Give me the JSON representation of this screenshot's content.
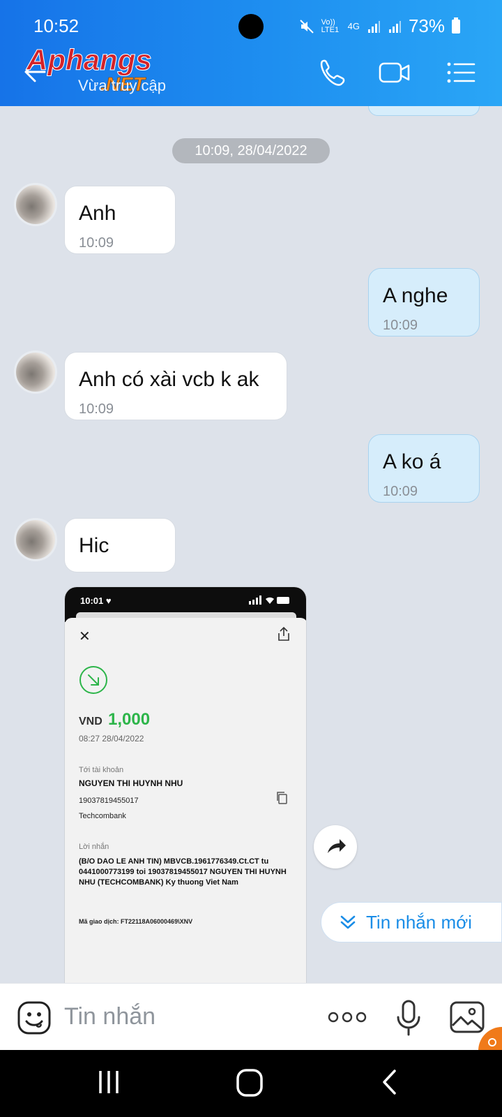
{
  "status_bar": {
    "time": "10:52",
    "network_line1": "Vo)) LTE1",
    "network_type": "4G",
    "battery": "73%"
  },
  "header": {
    "subtitle": "Vừa truy cập",
    "watermark_text": "Aphangs",
    "watermark_sub": ".NET",
    "icons": [
      "back-arrow-icon",
      "phone-icon",
      "video-call-icon",
      "menu-icon"
    ],
    "gradient_start": "#1673e8",
    "gradient_end": "#2aa6f6"
  },
  "chat": {
    "date_separator": "10:09, 28/04/2022",
    "messages": [
      {
        "side": "in",
        "text": "Anh",
        "time": "10:09"
      },
      {
        "side": "out",
        "text": "A nghe",
        "time": "10:09"
      },
      {
        "side": "in",
        "text": "Anh có xài vcb k ak",
        "time": "10:09"
      },
      {
        "side": "out",
        "text": "A ko á",
        "time": "10:09"
      },
      {
        "side": "in",
        "text": "Hic"
      }
    ],
    "outgoing_bubble_color": "#d6edfb",
    "incoming_bubble_color": "#ffffff"
  },
  "shared_image": {
    "phone_time": "10:01 ♥",
    "currency": "VND",
    "amount": "1,000",
    "amount_color": "#2db54a",
    "datetime": "08:27 28/04/2022",
    "to_account_label": "Tới tài khoản",
    "recipient_name": "NGUYEN THI HUYNH NHU",
    "account_number": "19037819455017",
    "bank": "Techcombank",
    "memo_label": "Lời nhắn",
    "memo_text": "(B/O DAO LE ANH TIN) MBVCB.1961776349.Ct.CT tu 0441000773199 toi 19037819455017 NGUYEN THI HUYNH NHU (TECHCOMBANK) Ky thuong Viet Nam",
    "transaction_id": "Mã giao dịch: FT22118A06000469\\XNV"
  },
  "new_messages_button": {
    "label": "Tin nhắn mới"
  },
  "composer": {
    "placeholder": "Tin nhắn",
    "icons": [
      "sticker-icon",
      "more-icon",
      "microphone-icon",
      "image-icon"
    ]
  },
  "nav_bar": {
    "icons": [
      "recents-icon",
      "home-icon",
      "back-icon"
    ]
  }
}
